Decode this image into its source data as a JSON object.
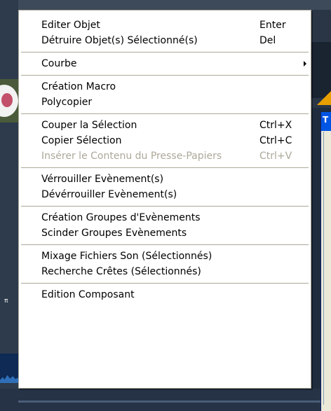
{
  "context_menu": {
    "groups": [
      [
        {
          "label": "Editer Objet",
          "shortcut": "Enter",
          "enabled": true
        },
        {
          "label": "Détruire Objet(s) Sélectionné(s)",
          "shortcut": "Del",
          "enabled": true
        }
      ],
      [
        {
          "label": "Courbe",
          "shortcut": "",
          "enabled": true,
          "has_submenu": true
        }
      ],
      [
        {
          "label": "Création Macro",
          "shortcut": "",
          "enabled": true
        },
        {
          "label": "Polycopier",
          "shortcut": "",
          "enabled": true
        }
      ],
      [
        {
          "label": "Couper la Sélection",
          "shortcut": "Ctrl+X",
          "enabled": true
        },
        {
          "label": "Copier Sélection",
          "shortcut": "Ctrl+C",
          "enabled": true
        },
        {
          "label": "Insérer le Contenu du Presse-Papiers",
          "shortcut": "Ctrl+V",
          "enabled": false
        }
      ],
      [
        {
          "label": "Vérrouiller Evènement(s)",
          "shortcut": "",
          "enabled": true
        },
        {
          "label": "Dévérrouiller Evènement(s)",
          "shortcut": "",
          "enabled": true
        }
      ],
      [
        {
          "label": "Création Groupes d'Evènements",
          "shortcut": "",
          "enabled": true
        },
        {
          "label": "Scinder Groupes Evènements",
          "shortcut": "",
          "enabled": true
        }
      ],
      [
        {
          "label": "Mixage Fichiers Son (Sélectionnés)",
          "shortcut": "",
          "enabled": true
        },
        {
          "label": "Recherche Crêtes (Sélectionnés)",
          "shortcut": "",
          "enabled": true
        }
      ],
      [
        {
          "label": "Edition Composant",
          "shortcut": "",
          "enabled": true
        }
      ]
    ]
  },
  "colors": {
    "menu_background": "#ffffff",
    "menu_border": "#aca899",
    "disabled_text": "#aca899",
    "dialog_titlebar": "#0055e5"
  },
  "icons": {
    "submenu": "chevron-right-icon"
  }
}
